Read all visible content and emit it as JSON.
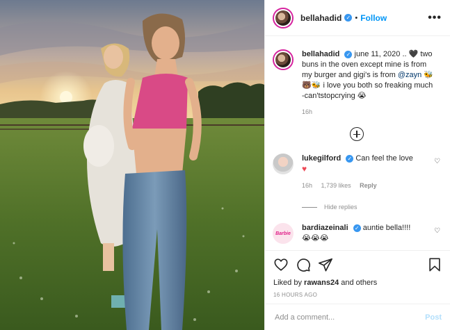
{
  "header": {
    "username": "bellahadid",
    "separator": "•",
    "follow_label": "Follow",
    "more_label": "•••"
  },
  "caption": {
    "username": "bellahadid",
    "date": "june 11, 2020 ..",
    "line1": "two buns in the oven except mine is from my burger and gigi's is from",
    "mention": "@zayn",
    "line2": "i love you both so freaking much -can'tstopcrying",
    "time": "16h"
  },
  "comments": [
    {
      "username": "lukegilford",
      "text": "Can feel the love",
      "time": "16h",
      "likes": "1,739 likes",
      "reply_label": "Reply",
      "hide_replies_label": "Hide replies"
    },
    {
      "username": "bardiazeinali",
      "text": "auntie bella!!!!",
      "avatar_text": "Barbie"
    }
  ],
  "actions": {
    "liked_prefix": "Liked by",
    "liked_user": "rawans24",
    "liked_suffix": "and others",
    "time_ago": "16 HOURS AGO"
  },
  "add_comment": {
    "placeholder": "Add a comment...",
    "post_label": "Post"
  },
  "icons": {
    "like": "heart-icon",
    "comment": "comment-icon",
    "share": "share-icon",
    "save": "bookmark-icon",
    "load_more": "plus-circle-icon",
    "verified": "verified-badge-icon"
  },
  "colors": {
    "link_blue": "#0095f6",
    "verified_blue": "#3897f0",
    "post_disabled": "#b2dffc",
    "muted": "#8e8e8e"
  }
}
